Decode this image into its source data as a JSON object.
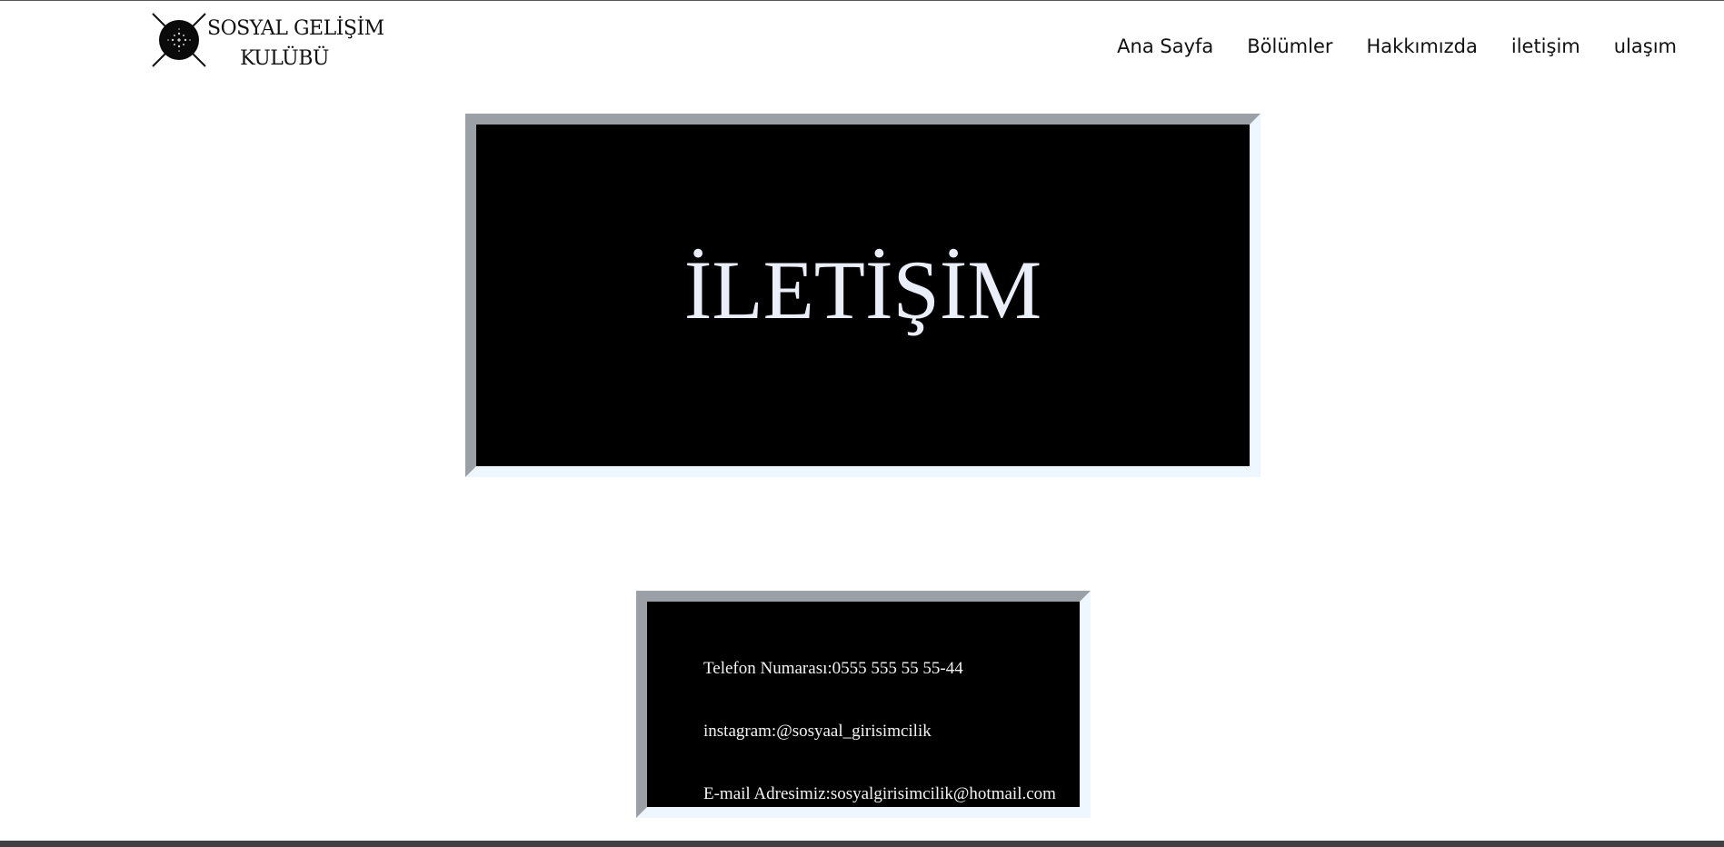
{
  "header": {
    "logo": {
      "line1": "SOSYAL GELİŞİM",
      "line2": "KULÜBÜ"
    },
    "nav": [
      {
        "label": "Ana Sayfa"
      },
      {
        "label": "Bölümler"
      },
      {
        "label": "Hakkımızda"
      },
      {
        "label": "iletişim"
      },
      {
        "label": "ulaşım"
      }
    ]
  },
  "hero": {
    "title": "İLETİŞİM"
  },
  "contact": {
    "phone": "Telefon Numarası:0555 555 55 55-44",
    "instagram": "instagram:@sosyaal_girisimcilik",
    "email": "E-mail Adresimiz:sosyalgirisimcilik@hotmail.com"
  },
  "colors": {
    "panel_background": "#000000",
    "frame_shadow": "#9aa0a6",
    "frame_highlight": "#eef7ff",
    "panel_text": "#e9eef8"
  }
}
